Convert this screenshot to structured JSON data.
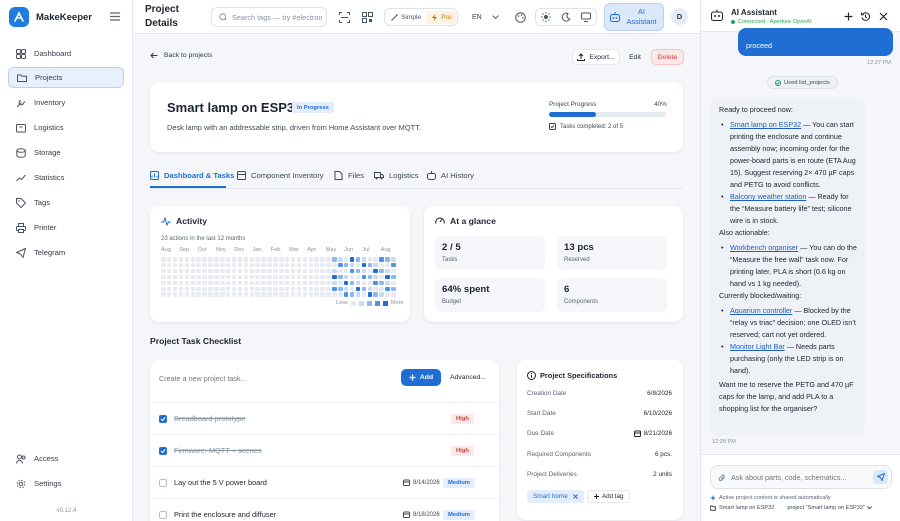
{
  "app": {
    "name": "MakeKeeper",
    "version": "v0.12.4"
  },
  "sidebar": {
    "items": [
      {
        "label": "Dashboard",
        "icon": "grid-icon"
      },
      {
        "label": "Projects",
        "icon": "folder-icon"
      },
      {
        "label": "Inventory",
        "icon": "wrench-icon"
      },
      {
        "label": "Logistics",
        "icon": "box-icon"
      },
      {
        "label": "Storage",
        "icon": "storage-icon"
      },
      {
        "label": "Statistics",
        "icon": "chart-icon"
      },
      {
        "label": "Tags",
        "icon": "tag-icon"
      },
      {
        "label": "Printer",
        "icon": "printer-icon"
      },
      {
        "label": "Telegram",
        "icon": "send-icon"
      }
    ],
    "bottom": [
      {
        "label": "Access",
        "icon": "users-icon"
      },
      {
        "label": "Settings",
        "icon": "gear-icon"
      }
    ]
  },
  "topbar": {
    "title": "Project Details",
    "search_placeholder": "Search tags — try #electron",
    "mode_simple": "Simple",
    "mode_pro": "Pro",
    "language": "EN",
    "ai_button": "AI Assistant",
    "avatar_initial": "D"
  },
  "project": {
    "back": "Back to projects",
    "export": "Export...",
    "edit": "Edit",
    "delete": "Delete",
    "name": "Smart lamp on ESP32",
    "status": "In Progress",
    "description": "Desk lamp with an addressable strip, driven from Home Assistant over MQTT.",
    "progress_label": "Project Progress",
    "progress_pct": "40%",
    "progress_value": 0.4,
    "tasks_completed": "Tasks completed: 2 of 5"
  },
  "tabs": [
    {
      "label": "Dashboard & Tasks",
      "icon": "dashboard-icon",
      "active": true
    },
    {
      "label": "Component Inventory",
      "icon": "inventory-icon",
      "active": false
    },
    {
      "label": "Files",
      "icon": "file-icon",
      "active": false
    },
    {
      "label": "Logistics",
      "icon": "truck-icon",
      "active": false
    },
    {
      "label": "AI History",
      "icon": "history-icon",
      "active": false
    }
  ],
  "activity": {
    "title": "Activity",
    "subtitle": "23 actions in the last 12 months",
    "months": [
      "Aug",
      "Sep",
      "Oct",
      "Nov",
      "Dec",
      "Jan",
      "Feb",
      "Mar",
      "Apr",
      "May",
      "Jun",
      "Jul",
      "Aug"
    ],
    "legend_less": "Less",
    "legend_more": "More"
  },
  "glance": {
    "title": "At a glance",
    "stats": [
      {
        "value": "2 / 5",
        "label": "Tasks"
      },
      {
        "value": "13 pcs",
        "label": "Reserved"
      },
      {
        "value": "64% spent",
        "label": "Budget"
      },
      {
        "value": "6",
        "label": "Components"
      }
    ]
  },
  "checklist": {
    "title": "Project Task Checklist",
    "new_placeholder": "Create a new project task...",
    "add": "Add",
    "advanced": "Advanced...",
    "tasks": [
      {
        "label": "Breadboard prototype",
        "done": true,
        "date": "",
        "priority": "High"
      },
      {
        "label": "Firmware: MQTT + scenes",
        "done": true,
        "date": "",
        "priority": "High"
      },
      {
        "label": "Lay out the 5 V power board",
        "done": false,
        "date": "8/14/2026",
        "priority": "Medium"
      },
      {
        "label": "Print the enclosure and diffuser",
        "done": false,
        "date": "8/18/2026",
        "priority": "Medium"
      }
    ]
  },
  "specs": {
    "title": "Project Specifications",
    "rows": [
      {
        "label": "Creation Date",
        "value": "6/8/2026"
      },
      {
        "label": "Start Date",
        "value": "6/10/2026"
      },
      {
        "label": "Due Date",
        "value": "8/21/2026"
      },
      {
        "label": "Required Components",
        "value": "6 pcs."
      },
      {
        "label": "Project Deliveries",
        "value": "2 units"
      }
    ],
    "tag": "Smart home",
    "add_tag": "Add tag"
  },
  "chat": {
    "title": "AI Assistant",
    "status": "Connected · Aperture OpenAI",
    "user_msg_tail": "proceed",
    "user_time": "12:27 PM",
    "tool_used": "Used list_projects",
    "intro": "Ready to proceed now:",
    "ready": [
      {
        "link": "Smart lamp on ESP32",
        "text": " — You can start printing the enclosure and continue assembly now; incoming order for the power-board parts is en route (ETA Aug 15). Suggest reserving 2× 470 µF caps and PETG to avoid conflicts."
      },
      {
        "link": "Balcony weather station",
        "text": " — Ready for the “Measure battery life” test; silicone wire is in stock."
      }
    ],
    "also_label": "Also actionable:",
    "also": [
      {
        "link": "Workbench organiser",
        "text": " — You can do the “Measure the free wall” task now. For printing later, PLA is short (0.6 kg on hand vs 1 kg needed)."
      }
    ],
    "blocked_label": "Currently blocked/waiting:",
    "blocked": [
      {
        "link": "Aquarium controller",
        "text": " — Blocked by the “relay vs triac” decision; one OLED isn’t reserved; cart not yet ordered."
      },
      {
        "link": "Monitor Light Bar",
        "text": " — Needs parts purchasing (only the LED strip is on hand)."
      }
    ],
    "closing": "Want me to reserve the PETG and 470 µF caps for the lamp, and add PLA to a shopping list for the organiser?",
    "assistant_time": "12:28 PM",
    "input_placeholder": "Ask about parts, code, schematics...",
    "context_note": "Active project context is shared automatically",
    "context_project": "Smart lamp on ESP32",
    "context_select": "project \"Smart lamp on ESP32\""
  },
  "colors": {
    "accent": "#1f6ed4",
    "danger": "#d63a3a",
    "pro": "#c2760b",
    "connected": "#22a35a"
  }
}
